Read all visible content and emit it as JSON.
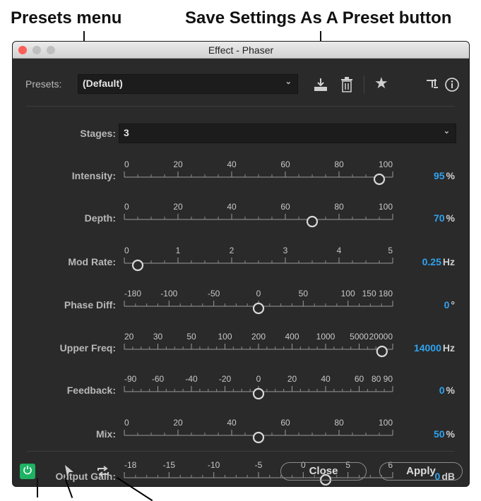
{
  "callouts": {
    "presets_menu": "Presets menu",
    "save_preset": "Save Settings As A Preset button"
  },
  "window": {
    "title": "Effect - Phaser"
  },
  "presets": {
    "label": "Presets:",
    "value": "(Default)"
  },
  "icons": {
    "save": "download-icon",
    "delete": "trash-icon",
    "favorite": "star-icon",
    "routing": "routing-icon",
    "info": "info-icon",
    "power": "power-icon",
    "play": "play-cursor-icon",
    "loop": "loop-icon"
  },
  "stages": {
    "label": "Stages:",
    "value": "3"
  },
  "params": [
    {
      "name": "Intensity:",
      "value": "95",
      "unit": "%",
      "ticks": [
        "0",
        "20",
        "40",
        "60",
        "80",
        "100"
      ],
      "knob": 0.95
    },
    {
      "name": "Depth:",
      "value": "70",
      "unit": "%",
      "ticks": [
        "0",
        "20",
        "40",
        "60",
        "80",
        "100"
      ],
      "knob": 0.7
    },
    {
      "name": "Mod Rate:",
      "value": "0.25",
      "unit": "Hz",
      "ticks": [
        "0",
        "1",
        "2",
        "3",
        "4",
        "5"
      ],
      "knob": 0.05
    },
    {
      "name": "Phase Diff:",
      "value": "0",
      "unit": "°",
      "ticks": [
        "-180",
        "-100",
        "-50",
        "0",
        "50",
        "100",
        "150 180"
      ],
      "knob": 0.5
    },
    {
      "name": "Upper Freq:",
      "value": "14000",
      "unit": "Hz",
      "ticks": [
        "20",
        "30",
        "50",
        "100",
        "200",
        "400",
        "1000",
        "5000",
        "20000"
      ],
      "knob": 0.96
    },
    {
      "name": "Feedback:",
      "value": "0",
      "unit": "%",
      "ticks": [
        "-90",
        "-60",
        "-40",
        "-20",
        "0",
        "20",
        "40",
        "60",
        "80 90"
      ],
      "knob": 0.5
    },
    {
      "name": "Mix:",
      "value": "50",
      "unit": "%",
      "ticks": [
        "0",
        "20",
        "40",
        "60",
        "80",
        "100"
      ],
      "knob": 0.5
    },
    {
      "name": "Output Gain:",
      "value": "0",
      "unit": "dB",
      "ticks": [
        "-18",
        "-15",
        "-10",
        "-5",
        "0",
        "5",
        "6"
      ],
      "knob": 0.75
    }
  ],
  "buttons": {
    "close": "Close",
    "apply": "Apply"
  },
  "colors": {
    "accent": "#2fa3f0",
    "power_on": "#1db363",
    "panel": "#2a2a2a"
  }
}
